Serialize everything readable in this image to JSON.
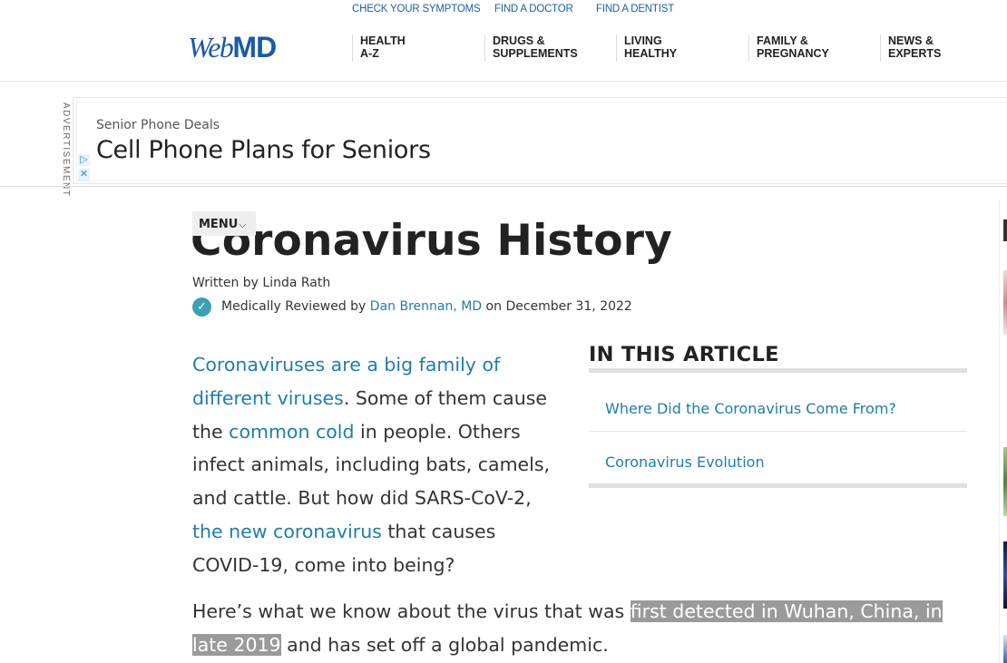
{
  "header": {
    "top_links": [
      "CHECK YOUR SYMPTOMS",
      "FIND A DOCTOR",
      "FIND A DENTIST"
    ],
    "logo_web": "Web",
    "logo_md": "MD",
    "nav": [
      {
        "line1": "HEALTH",
        "line2": "A-Z"
      },
      {
        "line1": "DRUGS &",
        "line2": "SUPPLEMENTS"
      },
      {
        "line1": "LIVING",
        "line2": "HEALTHY"
      },
      {
        "line1": "FAMILY &",
        "line2": "PREGNANCY"
      },
      {
        "line1": "NEWS &",
        "line2": "EXPERTS"
      }
    ]
  },
  "ad": {
    "label": "ADVERTISEMENT",
    "sponsor": "Senior Phone Deals",
    "headline": "Cell Phone Plans for Seniors",
    "choices_icon": "adchoices-icon",
    "close_icon": "close-icon",
    "choices_glyph": "▷",
    "close_glyph": "✕"
  },
  "menu": {
    "label": "MENU",
    "chevron": "⌵"
  },
  "article": {
    "title": "Coronavirus History",
    "written_by": "Written by Linda Rath",
    "reviewed_prefix": "Medically Reviewed by ",
    "reviewer": "Dan Brennan, MD",
    "reviewed_suffix": " on December 31, 2022",
    "check_glyph": "✓",
    "p1": {
      "link1": "Coronaviruses are a big family of different viruses",
      "t1": ". Some of them cause the ",
      "link2": "common cold",
      "t2": " in people. Others infect animals, including bats, camels, and cattle. But how did SARS-CoV-2, ",
      "link3": "the new coronavirus",
      "t3": " that causes COVID-19, come into being?"
    },
    "p2": {
      "t1": "Here’s what we know about the virus that was ",
      "highlight": "first detected in Wuhan, China, in late 2019",
      "t2": " and has set off a global pandemic."
    }
  },
  "toc": {
    "title": "IN THIS ARTICLE",
    "items": [
      "Where Did the Coronavirus Come From?",
      "Coronavirus Evolution"
    ]
  },
  "colors": {
    "link": "#1e7dad",
    "logo": "#1a5aa8",
    "check": "#3aa0b5",
    "highlight": "#9a9a9a"
  }
}
